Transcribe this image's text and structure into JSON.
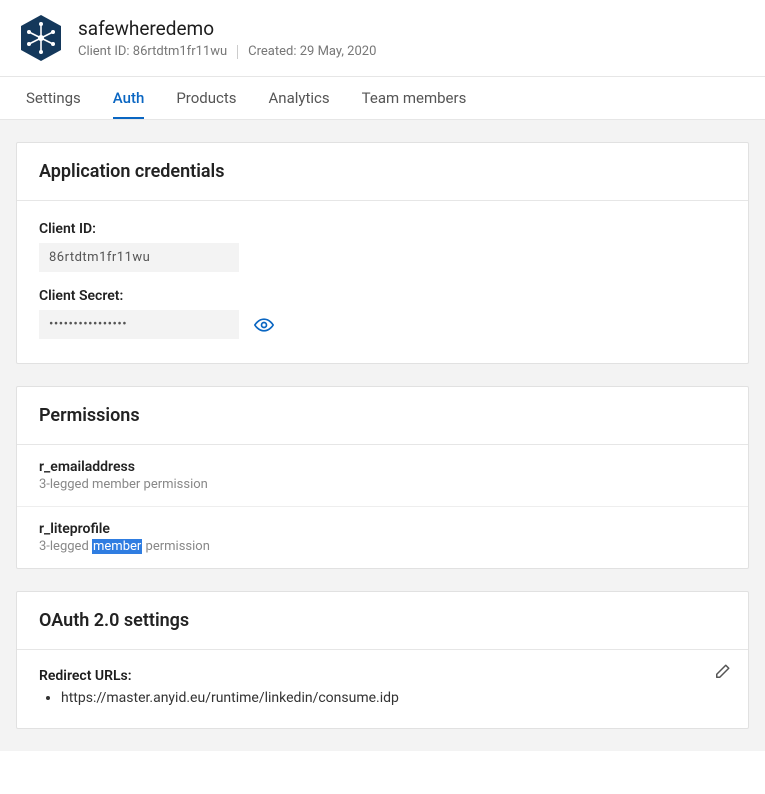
{
  "header": {
    "app_name": "safewheredemo",
    "client_id_label": "Client ID:",
    "client_id_value": "86rtdtm1fr11wu",
    "created_label": "Created:",
    "created_value": "29 May, 2020"
  },
  "tabs": [
    {
      "label": "Settings",
      "active": false
    },
    {
      "label": "Auth",
      "active": true
    },
    {
      "label": "Products",
      "active": false
    },
    {
      "label": "Analytics",
      "active": false
    },
    {
      "label": "Team members",
      "active": false
    }
  ],
  "credentials": {
    "title": "Application credentials",
    "client_id_label": "Client ID:",
    "client_id_value": "86rtdtm1fr11wu",
    "client_secret_label": "Client Secret:",
    "client_secret_masked": "••••••••••••••••"
  },
  "permissions": {
    "title": "Permissions",
    "items": [
      {
        "name": "r_emailaddress",
        "desc_pre": "3-legged member permission",
        "highlight": "",
        "desc_post": ""
      },
      {
        "name": "r_liteprofile",
        "desc_pre": "3-legged ",
        "highlight": "member",
        "desc_post": " permission"
      }
    ]
  },
  "oauth": {
    "title": "OAuth 2.0 settings",
    "redirect_label": "Redirect URLs:",
    "urls": [
      "https://master.anyid.eu/runtime/linkedin/consume.idp"
    ]
  }
}
